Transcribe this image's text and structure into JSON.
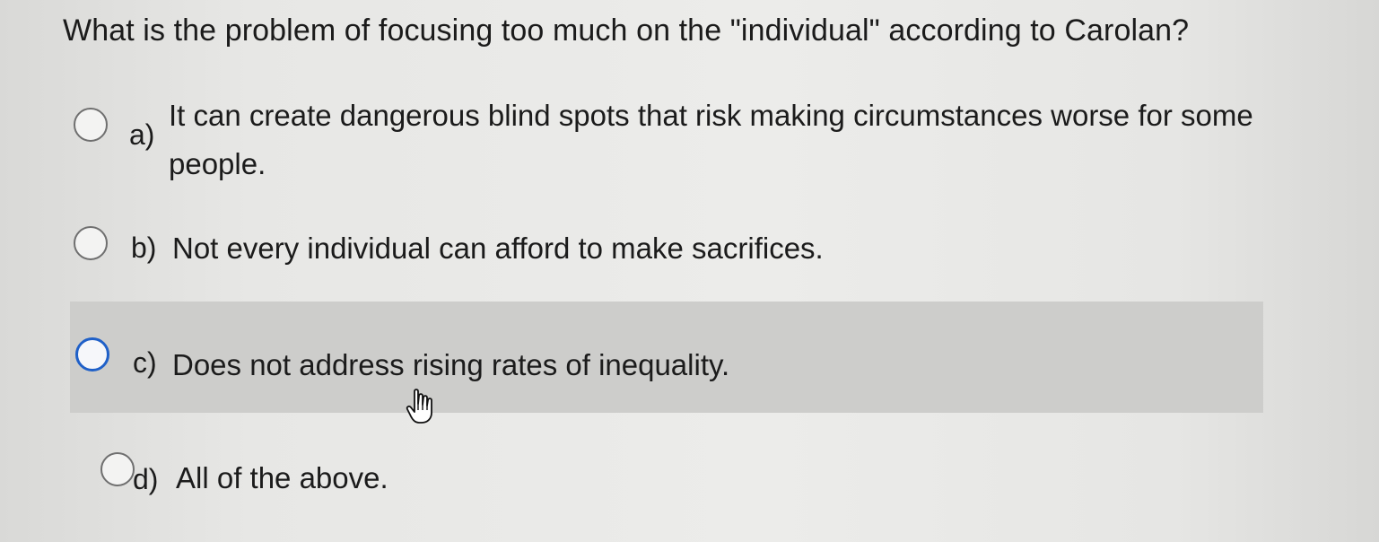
{
  "quiz": {
    "question": "What is the problem of focusing too much on the \"individual\" according to Carolan?",
    "options": [
      {
        "letter": "a)",
        "text": "It can create dangerous blind spots that risk making circumstances worse for some people."
      },
      {
        "letter": "b)",
        "text": "Not every individual can afford to make sacrifices."
      },
      {
        "letter": "c)",
        "text": "Does not address rising rates of inequality."
      },
      {
        "letter": "d)",
        "text": "All of the above."
      }
    ],
    "hovered_option": "c)"
  },
  "icons": {
    "radio": "radio-button-icon",
    "cursor": "hand-pointer-icon"
  },
  "colors": {
    "hover_background": "#cdcdcb",
    "focused_radio": "#1f60c8",
    "text": "#1b1b1b"
  }
}
